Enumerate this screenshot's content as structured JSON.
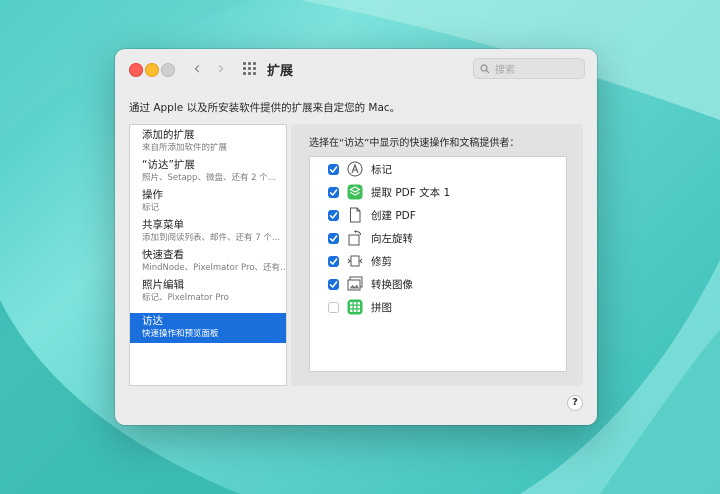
{
  "window": {
    "title": "扩展",
    "search_placeholder": "搜索",
    "description": "通过 Apple 以及所安装软件提供的扩展来自定您的 Mac。",
    "help_label": "?"
  },
  "sidebar": {
    "items": [
      {
        "title": "添加的扩展",
        "subtitle": "来自所添加软件的扩展",
        "active": false
      },
      {
        "title": "“访达”扩展",
        "subtitle": "照片、Setapp、微盘、还有 2 个…",
        "active": false
      },
      {
        "title": "操作",
        "subtitle": "标记",
        "active": false
      },
      {
        "title": "共享菜单",
        "subtitle": "添加到阅读列表、邮件、还有 7 个…",
        "active": false
      },
      {
        "title": "快速查看",
        "subtitle": "MindNode、Pixelmator Pro、还有…",
        "active": false
      },
      {
        "title": "照片编辑",
        "subtitle": "标记、Pixelmator Pro",
        "active": false
      },
      {
        "title": "访达",
        "subtitle": "快速操作和预览面板",
        "active": true
      }
    ]
  },
  "panel": {
    "label": "选择在“访达”中显示的快速操作和文稿提供者：",
    "extensions": [
      {
        "label": "标记",
        "checked": true,
        "icon": "markup-icon"
      },
      {
        "label": "提取 PDF 文本 1",
        "checked": true,
        "icon": "extract-pdf-text-icon"
      },
      {
        "label": "创建 PDF",
        "checked": true,
        "icon": "create-pdf-icon"
      },
      {
        "label": "向左旋转",
        "checked": true,
        "icon": "rotate-left-icon"
      },
      {
        "label": "修剪",
        "checked": true,
        "icon": "trim-icon"
      },
      {
        "label": "转换图像",
        "checked": true,
        "icon": "convert-image-icon"
      },
      {
        "label": "拼图",
        "checked": false,
        "icon": "grid-app-icon"
      }
    ]
  },
  "colors": {
    "accent": "#1a6fdc",
    "close": "#fe5f57",
    "minimize": "#febc2e",
    "maximize": "#cfcfcf"
  }
}
